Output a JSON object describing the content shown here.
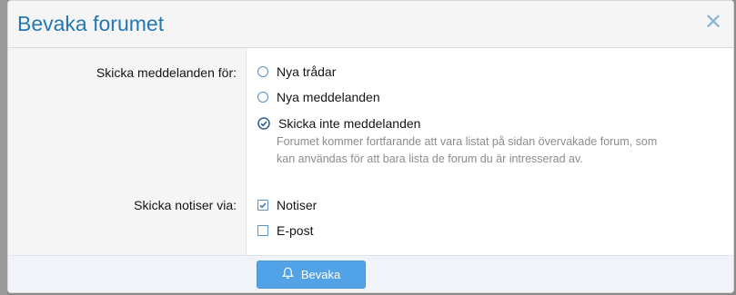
{
  "dialog": {
    "title": "Bevaka forumet",
    "close_icon": "close-icon"
  },
  "notify_for": {
    "label": "Skicka meddelanden för:",
    "options": [
      {
        "label": "Nya trådar",
        "checked": false
      },
      {
        "label": "Nya meddelanden",
        "checked": false
      },
      {
        "label": "Skicka inte meddelanden",
        "checked": true
      }
    ],
    "hint": "Forumet kommer fortfarande att vara listat på sidan övervakade forum, som kan användas för att bara lista de forum du är intresserad av."
  },
  "send_via": {
    "label": "Skicka notiser via:",
    "options": [
      {
        "label": "Notiser",
        "checked": true
      },
      {
        "label": "E-post",
        "checked": false
      }
    ]
  },
  "footer": {
    "submit_label": "Bevaka",
    "submit_icon": "bell-icon"
  },
  "colors": {
    "accent": "#2577b1",
    "button": "#52a2e8",
    "control": "#5a8fbf"
  }
}
